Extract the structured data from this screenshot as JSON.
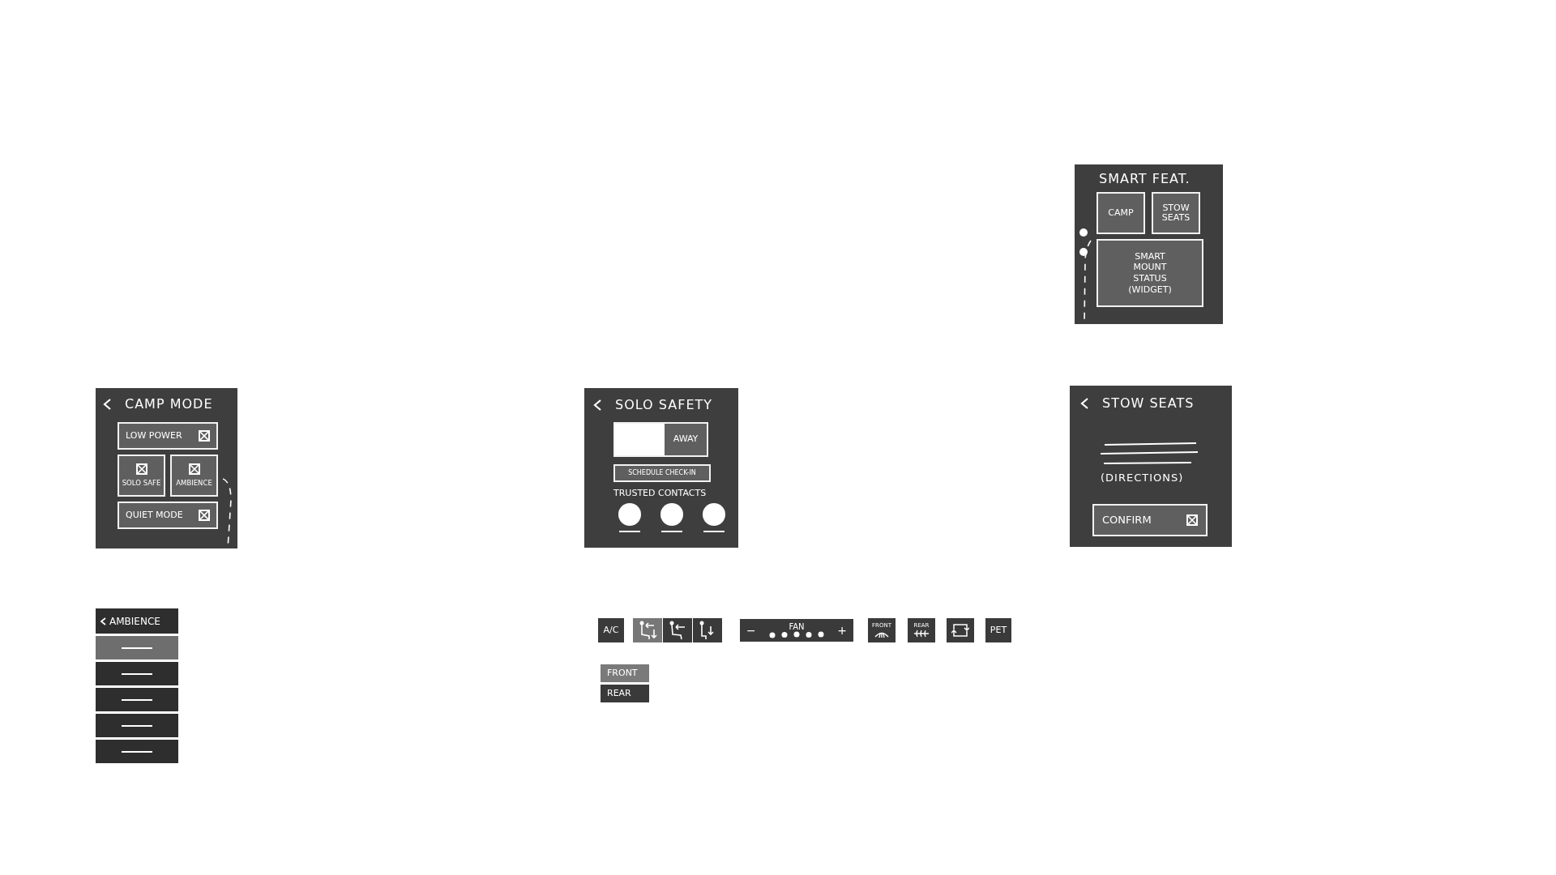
{
  "smart_features": {
    "title": "SMART FEAT.",
    "tiles": [
      {
        "label": "CAMP"
      },
      {
        "label": "STOW SEATS"
      }
    ],
    "widget_lines": [
      "SMART",
      "MOUNT",
      "STATUS",
      "(WIDGET)"
    ]
  },
  "camp_mode": {
    "title": "CAMP MODE",
    "options": [
      {
        "label": "LOW POWER",
        "kind": "wide"
      },
      {
        "label": "SOLO SAFE",
        "kind": "tile"
      },
      {
        "label": "AMBIENCE",
        "kind": "tile"
      },
      {
        "label": "QUIET MODE",
        "kind": "wide"
      }
    ]
  },
  "solo_safety": {
    "title": "SOLO SAFETY",
    "toggle": {
      "label": "AWAY",
      "on": true
    },
    "check_in_button": "SCHEDULE CHECK-IN",
    "contacts_label": "TRUSTED CONTACTS",
    "contacts": [
      {
        "kind": "avatar"
      },
      {
        "kind": "avatar"
      },
      {
        "kind": "avatar"
      }
    ]
  },
  "stow_seats": {
    "title": "STOW SEATS",
    "directions": "(DIRECTIONS)",
    "confirm_button": "CONFIRM"
  },
  "ambience": {
    "title": "AMBIENCE",
    "items": [
      {
        "selected": true
      },
      {
        "selected": false
      },
      {
        "selected": false
      },
      {
        "selected": false
      },
      {
        "selected": false
      }
    ]
  },
  "climate_bar": {
    "items": [
      {
        "kind": "text",
        "label": "A/C"
      },
      {
        "kind": "seats",
        "seats": [
          {
            "selected": true
          },
          {
            "selected": false
          },
          {
            "selected": false
          }
        ]
      },
      {
        "kind": "fan",
        "label": "FAN",
        "minus": "−",
        "plus": "+"
      },
      {
        "kind": "front_defrost",
        "label": "FRONT"
      },
      {
        "kind": "rear_defrost",
        "label": "REAR"
      },
      {
        "kind": "recirculate"
      },
      {
        "kind": "text",
        "label": "PET"
      }
    ]
  },
  "zones": [
    {
      "label": "FRONT",
      "selected": true
    },
    {
      "label": "REAR",
      "selected": false
    }
  ]
}
